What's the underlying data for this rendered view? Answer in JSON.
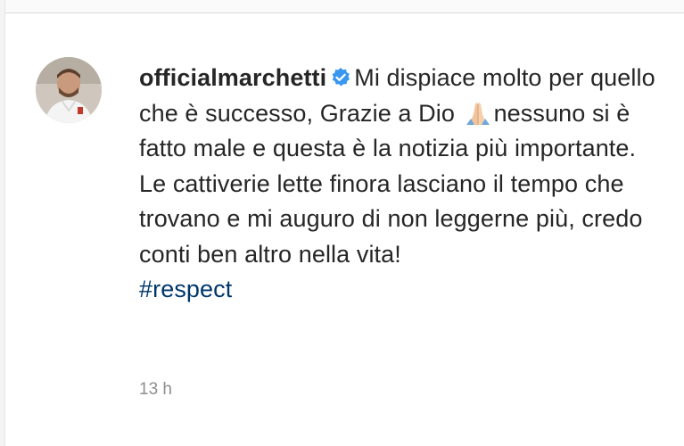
{
  "comment": {
    "username": "officialmarchetti",
    "verified_icon": "verified-badge-icon",
    "text_before_emoji": "Mi dispiace molto per quello che è successo, Grazie a Dio ",
    "emoji_icon": "folded-hands-icon",
    "text_after_emoji": "nessuno si è fatto male e questa è la notizia più importante. Le cattiverie lette finora lasciano il tempo che trovano e mi auguro di non leggerne più, credo conti ben altro nella vita!",
    "hashtag": "#respect",
    "timestamp": "13 h"
  },
  "colors": {
    "text": "#262626",
    "verified_blue": "#3897f0",
    "hashtag": "#00376b",
    "meta": "#8e8e8e"
  }
}
